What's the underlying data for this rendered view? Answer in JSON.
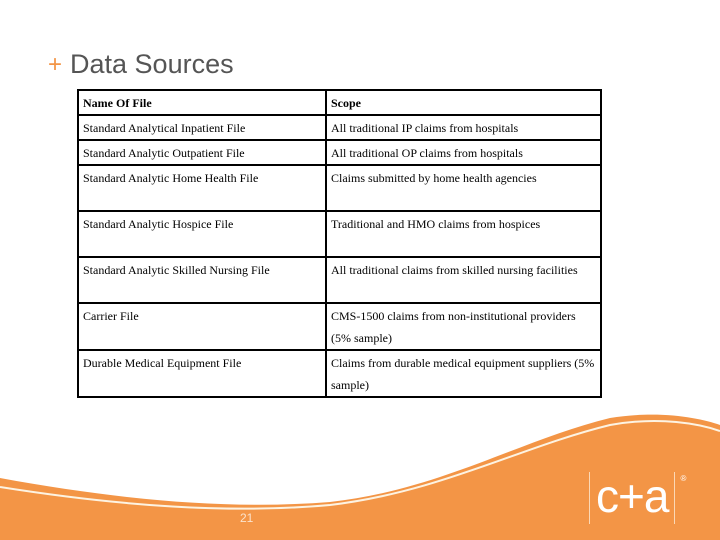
{
  "slide": {
    "title_prefix": "+",
    "title": "Data Sources",
    "page_number": "21"
  },
  "table": {
    "headers": [
      "Name Of File",
      "Scope"
    ],
    "rows": [
      {
        "name": "Standard Analytical Inpatient File",
        "scope": "All traditional IP claims from hospitals"
      },
      {
        "name": "Standard Analytic Outpatient File",
        "scope": "All traditional OP claims from hospitals"
      },
      {
        "name": "Standard Analytic Home Health File",
        "scope": "Claims submitted by home health agencies"
      },
      {
        "name": "Standard Analytic Hospice File",
        "scope": "Traditional and HMO claims from hospices"
      },
      {
        "name": "Standard Analytic Skilled Nursing File",
        "scope": "All traditional claims from skilled nursing facilities"
      },
      {
        "name": "Carrier File",
        "scope": "CMS-1500 claims from non-institutional providers (5% sample)"
      },
      {
        "name": "Durable Medical Equipment File",
        "scope": "Claims from durable medical equipment suppliers (5% sample)"
      }
    ]
  },
  "logo": {
    "text": "c+a",
    "registered_mark": "®"
  },
  "colors": {
    "accent_orange": "#f39546",
    "title_gray": "#555555",
    "swoosh_cream": "#fdf3e2"
  }
}
